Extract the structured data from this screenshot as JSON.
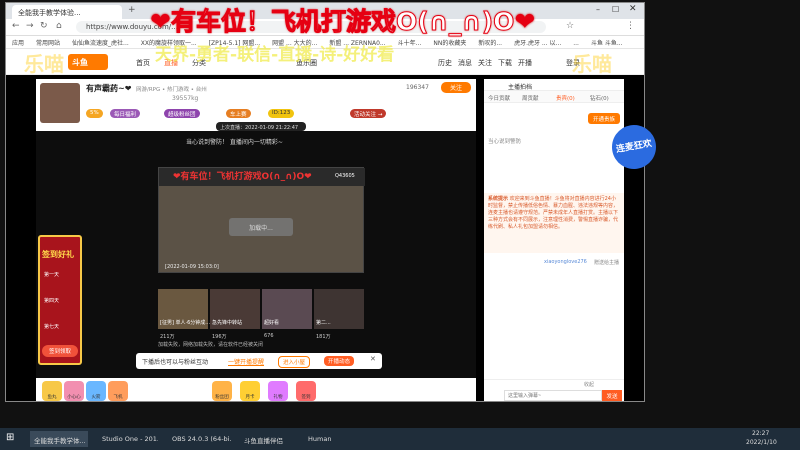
{
  "browser": {
    "tab_title": "全能我手教学体验...",
    "url": "https://www.douyu.com/...",
    "bookmarks": [
      "应用",
      "常用网站",
      "仙仙鱼流速度_虎社...",
      "XX的魔旋样领取一...",
      "[ZP14-5.1] 网盟...",
      "网盟 ... 大大的...",
      "新盟 ... ZERNNA0...",
      "斗十年...",
      "NN的收藏夹",
      "新叹的...",
      "虎牙.虎牙 ... 以...",
      "...",
      "斗鱼 斗鱼..."
    ]
  },
  "site_nav": {
    "links": [
      "首页",
      "直播",
      "分类",
      "鱼乐圈"
    ],
    "right": [
      "历史",
      "消息",
      "关注",
      "下载",
      "开播",
      "登录"
    ]
  },
  "overlay": {
    "title": "有车位！飞机打游戏O(∩_∩)O",
    "heart_left": "❤",
    "heart_right": "❤",
    "subtitle": "天界-勇者-联信-直播-诗-好好看",
    "deco_left": "乐喵",
    "deco_right": "乐喵"
  },
  "room": {
    "streamer_name": "有声霸药~❤",
    "category": "网游/RPG • 热门游戏 • 台州",
    "follow_count": "196347",
    "follow_label": "关注",
    "hot_value": "39557kg",
    "tags": [
      "5%",
      "每日福利",
      "超级粉丝团",
      "车上赛",
      "ID:123"
    ],
    "activity": "活动关注 →",
    "stream_time": "上次直播：2022-01-09 21:22:47",
    "tip": "当心说到警防！ 直播间内一切精彩~",
    "inner_title": "❤有车位！飞机打游戏O(∩_∩)O❤",
    "inner_id": "Q43605",
    "inner_timestamp": "[2022-01-09 15:03:0]",
    "loading": "加载中...",
    "video_items": [
      {
        "title": "[征男] 单人·6分钟成...",
        "stat": "211万"
      },
      {
        "title": "急先锋中转站",
        "stat": "196万"
      },
      {
        "title": "超好看",
        "stat": "676"
      },
      {
        "title": "第二...",
        "stat": "181万"
      }
    ],
    "load_more": "加载失败，网络加载失败，请在软件已经被关闭",
    "popup_text": "下播后也可以与粉丝互动",
    "popup_link": "一键开播提醒",
    "popup_btn1": "进入小屋",
    "popup_btn2": "开播动态",
    "bottom_gifts": [
      "鱼丸",
      "小心心",
      "火箭",
      "飞机",
      "粉丝团",
      "月卡",
      "礼物",
      "签到"
    ]
  },
  "right_panel": {
    "host_label": "主播拍档",
    "tabs": [
      "今日贡献",
      "周贡献",
      "贵宾(0)",
      "钻石(0)"
    ],
    "open_btn": "开通贵族",
    "badge_text": "当心说到警防",
    "notice_label": "系统提示",
    "notice_text": "欢迎来到斗鱼直播！斗鱼将对直播内容进行24小时监督，禁止传播低俗色情、暴力血腥、违法违规等内容，连麦主播也请遵守规范。严禁未成年人直播打赏。主播以下三种方式会有不同展示，注意理性消费，警惕直播诈骗，代练代刷、私人礼包加盟请勿相信。",
    "chat_user": "xiaoyonglove276",
    "chat_msg": "赠送给主播",
    "input_placeholder": "这里输入弹幕~",
    "send_btn": "发送",
    "check_label": "收起"
  },
  "side_left": {
    "title": "签到好礼",
    "days": [
      "第一天",
      "第四天",
      "第七天"
    ],
    "claim": "签到领取"
  },
  "side_right_badge": "连麦狂欢",
  "taskbar": {
    "items": [
      "全能我手教学体...",
      "Studio One - 201...",
      "OBS 24.0.3 (64-bi...",
      "斗鱼直播伴侣",
      "Human"
    ],
    "time": "22:27",
    "date": "2022/1/10"
  }
}
